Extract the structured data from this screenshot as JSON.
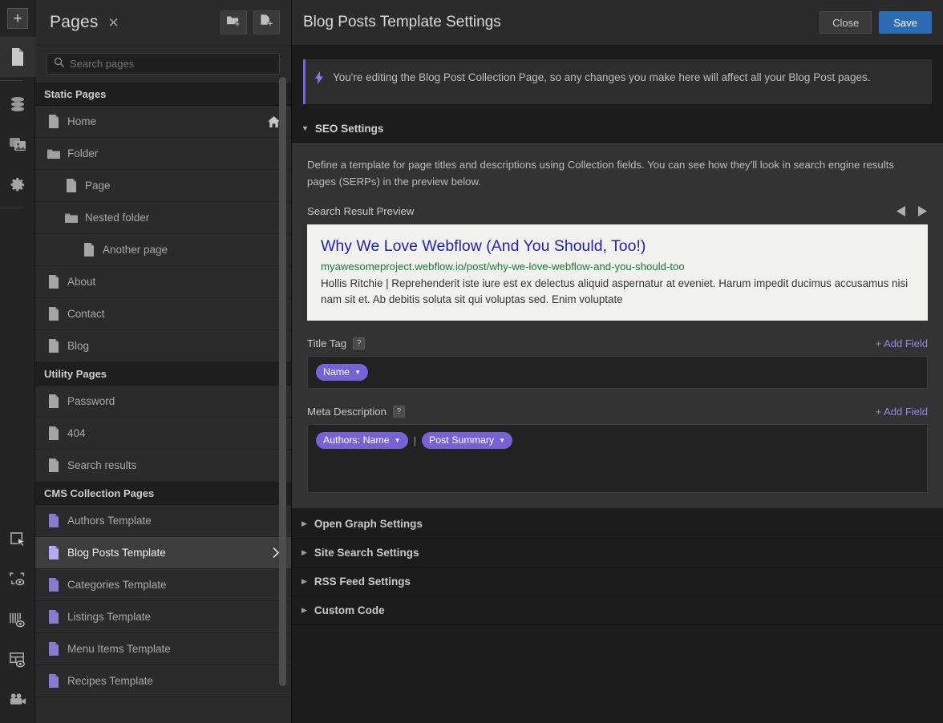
{
  "rail": {
    "top_items": [
      {
        "name": "add-element-button",
        "icon": "plus-icon",
        "active": false
      },
      {
        "name": "pages-panel-button",
        "icon": "page-icon",
        "active": true
      },
      {
        "name": "cms-panel-button",
        "icon": "database-icon",
        "active": false
      },
      {
        "name": "assets-panel-button",
        "icon": "images-icon",
        "active": false
      },
      {
        "name": "settings-panel-button",
        "icon": "gear-icon",
        "active": false
      }
    ],
    "bottom_items": [
      {
        "name": "select-tool-button",
        "icon": "cursor-icon"
      },
      {
        "name": "preview-marquee-button",
        "icon": "marquee-eye-icon"
      },
      {
        "name": "audit-panel-button",
        "icon": "bars-eye-icon"
      },
      {
        "name": "layout-preview-button",
        "icon": "layout-eye-icon"
      },
      {
        "name": "video-tutorials-button",
        "icon": "video-camera-icon"
      }
    ]
  },
  "pages_panel": {
    "title": "Pages",
    "close_label": "✕",
    "new_folder_tooltip": "New Folder",
    "new_page_tooltip": "New Page",
    "search": {
      "placeholder": "Search pages",
      "value": ""
    },
    "groups": [
      {
        "title": "Static Pages",
        "items": [
          {
            "label": "Home",
            "icon": "page-icon",
            "indent": 0,
            "selected": false,
            "badge": "home-icon"
          },
          {
            "label": "Folder",
            "icon": "folder-icon",
            "indent": 0,
            "selected": false
          },
          {
            "label": "Page",
            "icon": "page-icon",
            "indent": 1,
            "selected": false
          },
          {
            "label": "Nested folder",
            "icon": "folder-icon",
            "indent": 1,
            "selected": false
          },
          {
            "label": "Another page",
            "icon": "page-icon",
            "indent": 2,
            "selected": false
          },
          {
            "label": "About",
            "icon": "page-icon",
            "indent": 0,
            "selected": false
          },
          {
            "label": "Contact",
            "icon": "page-icon",
            "indent": 0,
            "selected": false
          },
          {
            "label": "Blog",
            "icon": "page-icon",
            "indent": 0,
            "selected": false
          }
        ]
      },
      {
        "title": "Utility Pages",
        "items": [
          {
            "label": "Password",
            "icon": "page-icon",
            "indent": 0,
            "selected": false
          },
          {
            "label": "404",
            "icon": "page-icon",
            "indent": 0,
            "selected": false
          },
          {
            "label": "Search results",
            "icon": "page-icon",
            "indent": 0,
            "selected": false
          }
        ]
      },
      {
        "title": "CMS Collection Pages",
        "items": [
          {
            "label": "Authors Template",
            "icon": "cms-page-icon",
            "indent": 0,
            "selected": false
          },
          {
            "label": "Blog Posts Template",
            "icon": "cms-page-icon",
            "indent": 0,
            "selected": true,
            "badge": "chevron-right-icon"
          },
          {
            "label": "Categories Template",
            "icon": "cms-page-icon",
            "indent": 0,
            "selected": false
          },
          {
            "label": "Listings Template",
            "icon": "cms-page-icon",
            "indent": 0,
            "selected": false
          },
          {
            "label": "Menu Items Template",
            "icon": "cms-page-icon",
            "indent": 0,
            "selected": false
          },
          {
            "label": "Recipes Template",
            "icon": "cms-page-icon",
            "indent": 0,
            "selected": false
          }
        ]
      }
    ]
  },
  "main": {
    "title": "Blog Posts Template Settings",
    "close_label": "Close",
    "save_label": "Save",
    "notice": {
      "icon": "lightning-icon",
      "text": "You're editing the Blog Post Collection Page, so any changes you make here will affect all your Blog Post pages."
    },
    "seo_section": {
      "title": "SEO Settings",
      "expanded": true,
      "description": "Define a template for page titles and descriptions using Collection fields. You can see how they'll look in search engine results pages (SERPs) in the preview below.",
      "preview_label": "Search Result Preview",
      "prev_icon": "chevron-left-icon",
      "next_icon": "chevron-right-icon",
      "serp": {
        "title": "Why We Love Webflow (And You Should, Too!)",
        "url": "myawesomeproject.webflow.io/post/why-we-love-webflow-and-you-should-too",
        "description": "Hollis Ritchie | Reprehenderit iste iure est ex delectus aliquid aspernatur at eveniet. Harum impedit ducimus accusamus nisi nam sit et. Ab debitis soluta sit qui voluptas sed. Enim voluptate"
      },
      "title_tag": {
        "label": "Title Tag",
        "help": "?",
        "add_field_label": "+ Add Field",
        "tokens": [
          {
            "label": "Name",
            "type": "token"
          }
        ]
      },
      "meta_description": {
        "label": "Meta Description",
        "help": "?",
        "add_field_label": "+ Add Field",
        "tokens": [
          {
            "label": "Authors: Name",
            "type": "token"
          },
          {
            "label": "|",
            "type": "separator"
          },
          {
            "label": "Post Summary",
            "type": "token"
          }
        ]
      }
    },
    "collapsed_sections": [
      {
        "title": "Open Graph Settings"
      },
      {
        "title": "Site Search Settings"
      },
      {
        "title": "RSS Feed Settings"
      },
      {
        "title": "Custom Code"
      }
    ]
  },
  "colors": {
    "accent_purple": "#7762d4",
    "save_blue": "#2d6cb5",
    "serp_title": "#2723a5",
    "serp_url": "#1a7a33",
    "panel_bg": "#2b2b2b",
    "section_bg": "#333333"
  }
}
